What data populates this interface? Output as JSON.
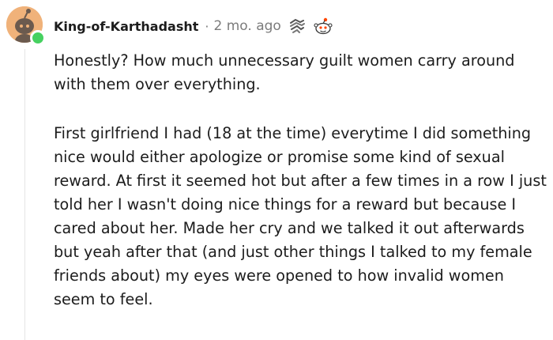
{
  "comment": {
    "author": "King-of-Karthadasht",
    "separator": "·",
    "timestamp": "2 mo. ago",
    "avatar_icon": "snoo-avatar-icon",
    "online_color": "#46d160",
    "award_icons": [
      "scribble-award-icon",
      "snoo-face-award-icon"
    ],
    "paragraphs": [
      "Honestly? How much unnecessary guilt women carry around with them over everything.",
      "First girlfriend I had (18 at the time) everytime I did something nice would either apologize or promise some kind of sexual reward. At first it seemed hot but after a few times in a row I just told her I wasn't doing nice things for a reward but because I cared about her. Made her cry and we talked it out afterwards but yeah after that (and just other things I talked to my female friends about) my eyes were opened to how invalid women seem to feel."
    ]
  }
}
